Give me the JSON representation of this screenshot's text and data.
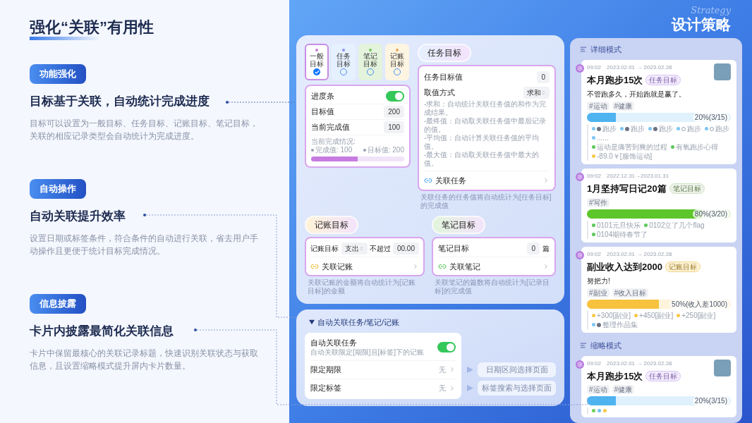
{
  "slide": {
    "title": "强化“关联”有用性",
    "brand_script": "Strategy",
    "brand_title": "设计策略"
  },
  "sections": [
    {
      "tag": "功能强化",
      "heading": "目标基于关联，自动统计完成进度",
      "body": "目标可以设置为一般目标、任务目标、记账目标、笔记目标，关联的相应记录类型会自动统计为完成进度。"
    },
    {
      "tag": "自动操作",
      "heading": "自动关联提升效率",
      "body": "设置日期或标签条件，符合条件的自动进行关联，省去用户手动操作且更便于统计目标完成情况。"
    },
    {
      "tag": "信息披露",
      "heading": "卡片内披露最简化关联信息",
      "body": "卡片中保留最核心的关联记录标题，快速识别关联状态与获取信息，且设置缩略模式提升屏内卡片数量。"
    }
  ],
  "goal_editor": {
    "goal_types": [
      {
        "label": "一般目标",
        "kind": "general",
        "color": "#c77be0",
        "selected": true
      },
      {
        "label": "任务目标",
        "kind": "task",
        "color": "#8b8ff0",
        "selected": false
      },
      {
        "label": "笔记目标",
        "kind": "note",
        "color": "#7cc35e",
        "selected": false
      },
      {
        "label": "记账目标",
        "kind": "ledger",
        "color": "#f2a65a",
        "selected": false
      }
    ],
    "progress": {
      "rows": [
        {
          "kind": "toggle",
          "label": "进度条",
          "on": true
        },
        {
          "kind": "value",
          "label": "目标值",
          "value": "200"
        },
        {
          "kind": "value",
          "label": "当前完成值",
          "value": "100"
        }
      ],
      "summary_title": "当前完成情况:",
      "completed": "完成值: 100",
      "target": "目标值: 200",
      "level": 0.5
    },
    "task_goal": {
      "title": "任务目标",
      "rows": [
        {
          "kind": "value",
          "label": "任务目标值",
          "value": "0"
        },
        {
          "kind": "select",
          "label": "取值方式",
          "value": "求和"
        }
      ],
      "notes": [
        "-求和：自动统计关联任务值的和作为完成结果。",
        "-最终值：自动取关联任务值中最后记录的值。",
        "-平均值：自动计算关联任务值的平均值。",
        "-最大值：自动取关联任务值中最大的值。"
      ],
      "link": "关联任务",
      "caption": "关联任务的任务值将自动统计为[任务目标]的完成值"
    },
    "ledger_goal": {
      "title": "记账目标",
      "label": "记账目标",
      "select": "支出",
      "condition": "不超过",
      "value": "00.00",
      "link": "关联记账",
      "caption": "关联记账的金额将自动统计为[记账目标]的金额"
    },
    "note_goal": {
      "title": "笔记目标",
      "label": "笔记目标",
      "value": "0",
      "unit": "篇",
      "link": "关联笔记",
      "caption": "关联笔记的篇数将自动统计为[记录目标]的完成值"
    }
  },
  "auto_link": {
    "title": "自动关联任务/笔记/记账",
    "toggle": {
      "label": "自动关联任务",
      "hint": "自动关联限定[期限]且[标签]下的记账",
      "on": true
    },
    "rows": [
      {
        "label": "限定期限",
        "value": "无",
        "target": "日期区间选择页面"
      },
      {
        "label": "限定标签",
        "value": "无",
        "target": "标签搜索与选择页面"
      }
    ]
  },
  "timeline": {
    "detail_header": "详细模式",
    "detail_cards": [
      {
        "time": "09:02",
        "range": "2023.02.01 → 2023.02.28",
        "title": "本月跑步15次",
        "kind": "task",
        "badge": "任务目标",
        "note": "不管跑多久，开始跑就是赢了。",
        "tags": [
          "#运动",
          "#健康"
        ],
        "photo": true,
        "color": "#4fb3f0",
        "level": 0.2,
        "progress_text": "20%(3/15)",
        "lines": [
          {
            "items": [
              {
                "text": "跑步",
                "color": "#7cc6f5",
                "checked": true
              },
              {
                "text": "跑步",
                "color": "#7cc6f5",
                "checked": true
              },
              {
                "text": "跑步",
                "color": "#7cc6f5",
                "checked": true
              },
              {
                "text": "跑步",
                "color": "#7cc6f5",
                "checked": false
              },
              {
                "text": "跑步",
                "color": "#7cc6f5",
                "checked": false
              },
              {
                "text": "......",
                "color": "#7cc6f5"
              }
            ]
          },
          {
            "items": [
              {
                "text": "运动是痛苦到爽的过程",
                "color": "#5ac85a"
              },
              {
                "text": "有氧跑步心得",
                "color": "#5ac85a"
              }
            ]
          },
          {
            "items": [
              {
                "text": "-89.0￥[服饰运动]",
                "color": "#f7c948"
              }
            ]
          }
        ]
      },
      {
        "time": "09:02",
        "range": "2022.12.31→2023.01.31",
        "title": "1月坚持写日记20篇",
        "kind": "note",
        "badge": "笔记目标",
        "tags": [
          "#写作"
        ],
        "photo": false,
        "color": "#5cc62a",
        "level": 0.8,
        "progress_text": "80%(3/20)",
        "lines": [
          {
            "items": [
              {
                "text": "0101元旦快乐",
                "color": "#5ac85a"
              },
              {
                "text": "0102立了几个flag",
                "color": "#5ac85a"
              },
              {
                "text": "0104期待春节了",
                "color": "#5ac85a"
              }
            ]
          }
        ]
      },
      {
        "time": "09:02",
        "range": "2023.02.01 → 2023.02.28",
        "title": "副业收入达到2000",
        "kind": "ledger",
        "badge": "记账目标",
        "note": "努把力!",
        "tags": [
          "#副业",
          "#收入目标"
        ],
        "photo": false,
        "color": "#f7c23e",
        "level": 0.5,
        "progress_text": "50%(收入差1000)",
        "lines": [
          {
            "items": [
              {
                "text": "+300[副业]",
                "color": "#f7c948"
              },
              {
                "text": "+450[副业]",
                "color": "#f7c948"
              },
              {
                "text": "+250[副业]",
                "color": "#f7c948"
              }
            ]
          },
          {
            "items": [
              {
                "text": "整理作品集",
                "color": "#7cc6f5",
                "checked": true
              }
            ]
          }
        ]
      }
    ],
    "compact_header": "缩略模式",
    "compact_cards": [
      {
        "time": "09:02",
        "range": "2023.02.01 → 2023.02.28",
        "title": "本月跑步15次",
        "kind": "task",
        "badge": "任务目标",
        "tags": [
          "#运动",
          "#健康"
        ],
        "photo": true,
        "color": "#4fb3f0",
        "level": 0.2,
        "progress_text": "20%(3/15)",
        "dots": [
          {
            "color": "#6fd05a"
          },
          {
            "color": "#6ec3f4"
          },
          {
            "color": "#f7c948"
          }
        ]
      }
    ]
  }
}
